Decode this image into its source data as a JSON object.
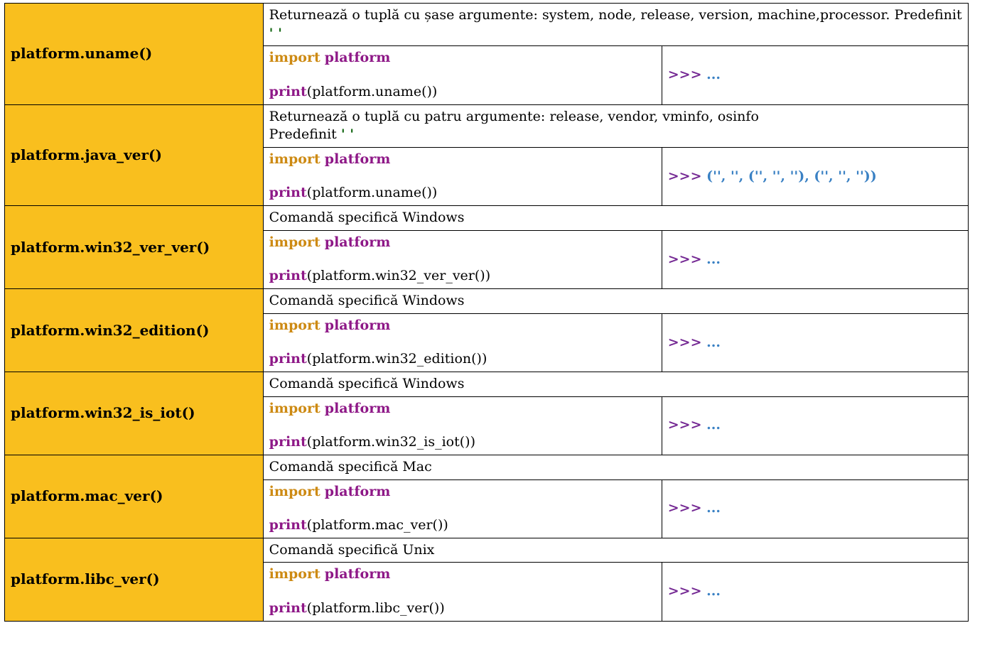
{
  "code_keywords": {
    "import": "import",
    "module": "platform",
    "print": "print"
  },
  "rows": [
    {
      "name": "platform.uname()",
      "desc_pre": "Returnează o tuplă cu șase argumente: system, node, release, version, machine,processor. Predefinit ",
      "desc_predef": "' '",
      "desc_post": "",
      "code_call": "(platform.uname())",
      "out_prompt": ">>> ",
      "out_value": "..."
    },
    {
      "name": "platform.java_ver()",
      "desc_pre": "Returnează o tuplă cu patru argumente: release, vendor, vminfo, osinfo\nPredefinit ",
      "desc_predef": "' '",
      "desc_post": "",
      "code_call": "(platform.uname())",
      "out_prompt": ">>> ",
      "out_value": "('', '', ('', '', ''), ('', '', ''))"
    },
    {
      "name": "platform.win32_ver_ver()",
      "desc_pre": "Comandă specifică Windows",
      "desc_predef": "",
      "desc_post": "",
      "code_call": "(platform.win32_ver_ver())",
      "out_prompt": ">>> ",
      "out_value": "..."
    },
    {
      "name": "platform.win32_edition()",
      "desc_pre": "Comandă specifică Windows",
      "desc_predef": "",
      "desc_post": "",
      "code_call": "(platform.win32_edition())",
      "out_prompt": ">>> ",
      "out_value": "..."
    },
    {
      "name": "platform.win32_is_iot()",
      "desc_pre": "Comandă specifică Windows",
      "desc_predef": "",
      "desc_post": "",
      "code_call": "(platform.win32_is_iot())",
      "out_prompt": ">>> ",
      "out_value": "..."
    },
    {
      "name": "platform.mac_ver()",
      "desc_pre": "Comandă specifică Mac",
      "desc_predef": "",
      "desc_post": "",
      "code_call": "(platform.mac_ver())",
      "out_prompt": ">>> ",
      "out_value": "..."
    },
    {
      "name": "platform.libc_ver()",
      "desc_pre": "Comandă specifică Unix",
      "desc_predef": "",
      "desc_post": "",
      "code_call": "(platform.libc_ver())",
      "out_prompt": ">>> ",
      "out_value": "..."
    }
  ]
}
